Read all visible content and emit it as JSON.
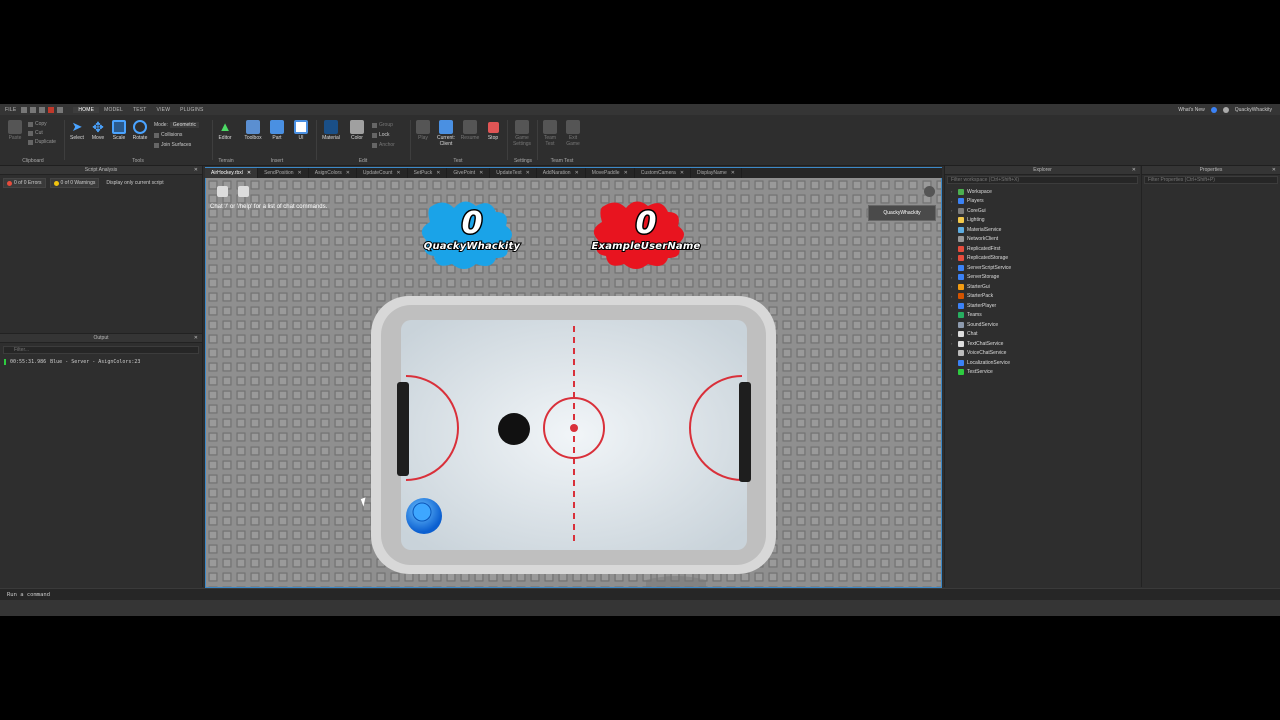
{
  "menubar": {
    "file": "FILE",
    "tabs": [
      "HOME",
      "MODEL",
      "TEST",
      "VIEW",
      "PLUGINS"
    ],
    "whats_new": "What's New",
    "user": "QuackyWhackity"
  },
  "ribbon": {
    "clipboard": {
      "paste": "Paste",
      "copy": "Copy",
      "cut": "Cut",
      "duplicate": "Duplicate",
      "label": "Clipboard"
    },
    "tools": {
      "select": "Select",
      "move": "Move",
      "scale": "Scale",
      "rotate": "Rotate",
      "mode_label": "Mode:",
      "mode_value": "Geometric",
      "collisions": "Collisions",
      "join_surfaces": "Join Surfaces",
      "label": "Tools"
    },
    "terrain": {
      "editor": "Editor",
      "label": "Terrain"
    },
    "insert": {
      "toolbox": "Toolbox",
      "part": "Part",
      "ui": "UI",
      "label": "Insert"
    },
    "edit": {
      "material": "Material",
      "color": "Color",
      "group": "Group",
      "lock": "Lock",
      "anchor": "Anchor",
      "label": "Edit"
    },
    "test": {
      "play": "Play",
      "current_client": "Current: Client",
      "resume": "Resume",
      "stop": "Stop",
      "label": "Test"
    },
    "settings": {
      "game_settings": "Game Settings",
      "label": "Settings"
    },
    "team_test": {
      "team_test": "Team Test",
      "exit_game": "Exit Game",
      "label": "Team Test"
    }
  },
  "script_analysis": {
    "title": "Script Analysis",
    "errors": "0 of 0 Errors",
    "warnings": "0 of 0 Warnings",
    "display_only": "Display only current script"
  },
  "output": {
    "title": "Output",
    "filter_placeholder": "Filter...",
    "lines": [
      {
        "time": "00:55:31.986",
        "text": "Blue  -  Server - AsignColors:23"
      }
    ]
  },
  "editor_tabs": [
    {
      "label": "AirHockey.rbxl",
      "active": true
    },
    {
      "label": "SendPosition"
    },
    {
      "label": "AsignColors"
    },
    {
      "label": "UpdateCount"
    },
    {
      "label": "SetPuck"
    },
    {
      "label": "GivePoint"
    },
    {
      "label": "UpdateText"
    },
    {
      "label": "AddNaration"
    },
    {
      "label": "MovePaddle"
    },
    {
      "label": "CustomCamera"
    },
    {
      "label": "DisplayName"
    }
  ],
  "viewport": {
    "chat_hint": "Chat '/' or '/help' for a list of chat commands.",
    "player_badge": "QuackyWhackity",
    "blue_score": "0",
    "blue_name": "QuackyWhackity",
    "red_score": "0",
    "red_name": "ExampleUserName",
    "colors": {
      "blue": "#1aa3e8",
      "red": "#e8141f",
      "table_rail": "#d9d9d9",
      "ice": "#dfe8ee",
      "line_red": "#d9303a"
    }
  },
  "explorer": {
    "title": "Explorer",
    "filter_placeholder": "Filter workspace (Ctrl+Shift+X)",
    "items": [
      {
        "label": "Workspace",
        "color": "#4caf50"
      },
      {
        "label": "Players",
        "color": "#3b82f6"
      },
      {
        "label": "CoreGui",
        "color": "#7c7c7c"
      },
      {
        "label": "Lighting",
        "color": "#f2c94c"
      },
      {
        "label": "MaterialService",
        "color": "#5dade2"
      },
      {
        "label": "NetworkClient",
        "color": "#999999"
      },
      {
        "label": "ReplicatedFirst",
        "color": "#e74c3c"
      },
      {
        "label": "ReplicatedStorage",
        "color": "#e74c3c"
      },
      {
        "label": "ServerScriptService",
        "color": "#3b82f6"
      },
      {
        "label": "ServerStorage",
        "color": "#3b82f6"
      },
      {
        "label": "StarterGui",
        "color": "#f39c12"
      },
      {
        "label": "StarterPack",
        "color": "#d35400"
      },
      {
        "label": "StarterPlayer",
        "color": "#3b82f6"
      },
      {
        "label": "Teams",
        "color": "#27ae60"
      },
      {
        "label": "SoundService",
        "color": "#8e9bae"
      },
      {
        "label": "Chat",
        "color": "#dddddd"
      },
      {
        "label": "TextChatService",
        "color": "#dddddd"
      },
      {
        "label": "VoiceChatService",
        "color": "#bbbbbb"
      },
      {
        "label": "LocalizationService",
        "color": "#3b82f6"
      },
      {
        "label": "TestService",
        "color": "#2ecc40"
      }
    ]
  },
  "properties": {
    "title": "Properties",
    "filter_placeholder": "Filter Properties (Ctrl+Shift+P)"
  },
  "command_bar": {
    "placeholder": "Run a command"
  }
}
